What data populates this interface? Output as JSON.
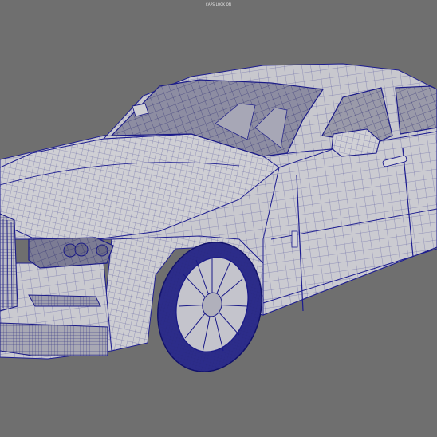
{
  "viewport": {
    "status_text": "CAPS LOCK ON",
    "background_color": "#6f6f6f",
    "display_mode": "shaded-wireframe-on-shaded",
    "selection_color": "#1a1aa8"
  },
  "scene": {
    "model_name": "",
    "object_icon": "car-model-icon"
  }
}
